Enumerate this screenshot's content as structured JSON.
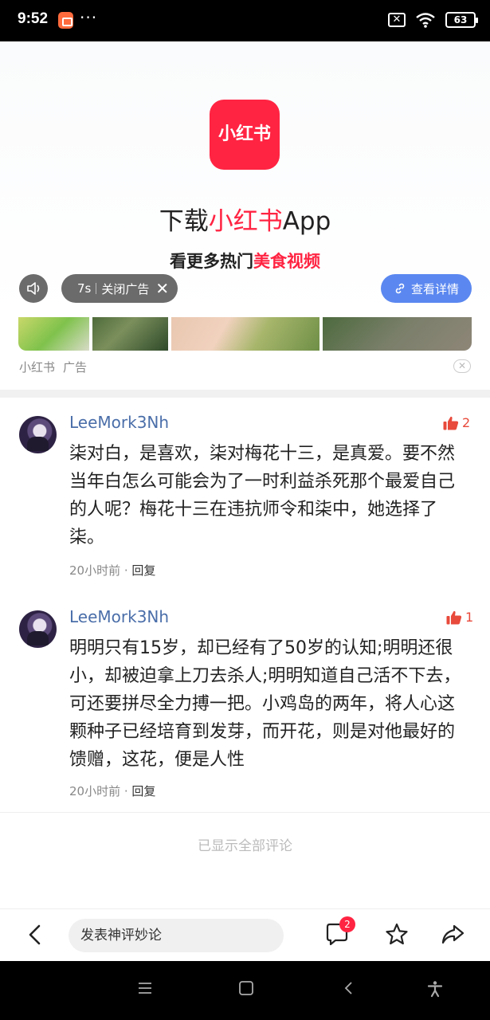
{
  "status_bar": {
    "time": "9:52",
    "dots": "···",
    "battery": "63",
    "icons": [
      "app-notification-icon",
      "sim-off-icon",
      "wifi-icon",
      "battery-icon"
    ]
  },
  "ad": {
    "logo_text": "小红书",
    "title_prefix": "下载",
    "title_highlight": "小红书",
    "title_suffix": "App",
    "subtitle_prefix": "看更多热门",
    "subtitle_highlight": "美食视频",
    "countdown": "7s",
    "close_label": "关闭广告",
    "details_label": "查看详情",
    "source": "小红书",
    "tag": "广告",
    "accent_color": "#ff2442",
    "button_color": "#5b88f0"
  },
  "comments": [
    {
      "user": "LeeMork3Nh",
      "likes": "2",
      "text": "柒对白，是喜欢，柒对梅花十三，是真爱。要不然当年白怎么可能会为了一时利益杀死那个最爱自己的人呢？梅花十三在违抗师令和柒中，她选择了柒。",
      "time": "20小时前",
      "reply": "回复"
    },
    {
      "user": "LeeMork3Nh",
      "likes": "1",
      "text": "明明只有15岁，却已经有了50岁的认知;明明还很小，却被迫拿上刀去杀人;明明知道自己活不下去，可还要拼尽全力搏一把。小鸡岛的两年，将人心这颗种子已经培育到发芽，而开花，则是对他最好的馈赠，这花，便是人性",
      "time": "20小时前",
      "reply": "回复"
    }
  ],
  "footer_note": "已显示全部评论",
  "bottom_bar": {
    "input_placeholder": "发表神评妙论",
    "comment_badge": "2"
  }
}
